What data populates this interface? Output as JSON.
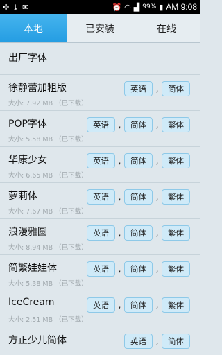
{
  "statusbar": {
    "battery": "99%",
    "time": "AM 9:08"
  },
  "tabs": [
    "本地",
    "已安装",
    "在线"
  ],
  "fonts": [
    {
      "name": "出厂字体",
      "size": "",
      "buttons": []
    },
    {
      "name": "徐静蕾加粗版",
      "size": "大小: 7.92 MB （已下载）",
      "buttons": [
        "英语",
        "简体"
      ]
    },
    {
      "name": "POP字体",
      "size": "大小: 5.58 MB （已下载）",
      "buttons": [
        "英语",
        "简体",
        "繁体"
      ]
    },
    {
      "name": "华康少女",
      "size": "大小: 6.65 MB （已下载）",
      "buttons": [
        "英语",
        "简体",
        "繁体"
      ]
    },
    {
      "name": "萝莉体",
      "size": "大小: 7.67 MB （已下载）",
      "buttons": [
        "英语",
        "简体",
        "繁体"
      ]
    },
    {
      "name": "浪漫雅圆",
      "size": "大小: 8.94 MB （已下载）",
      "buttons": [
        "英语",
        "简体",
        "繁体"
      ]
    },
    {
      "name": "简繁娃娃体",
      "size": "大小: 5.38 MB （已下载）",
      "buttons": [
        "英语",
        "简体",
        "繁体"
      ]
    },
    {
      "name": "IceCream",
      "size": "大小: 2.51 MB （已下载）",
      "buttons": [
        "英语",
        "简体",
        "繁体"
      ]
    },
    {
      "name": "方正少儿简体",
      "size": "",
      "buttons": [
        "英语",
        "简体"
      ]
    }
  ],
  "separator": ","
}
